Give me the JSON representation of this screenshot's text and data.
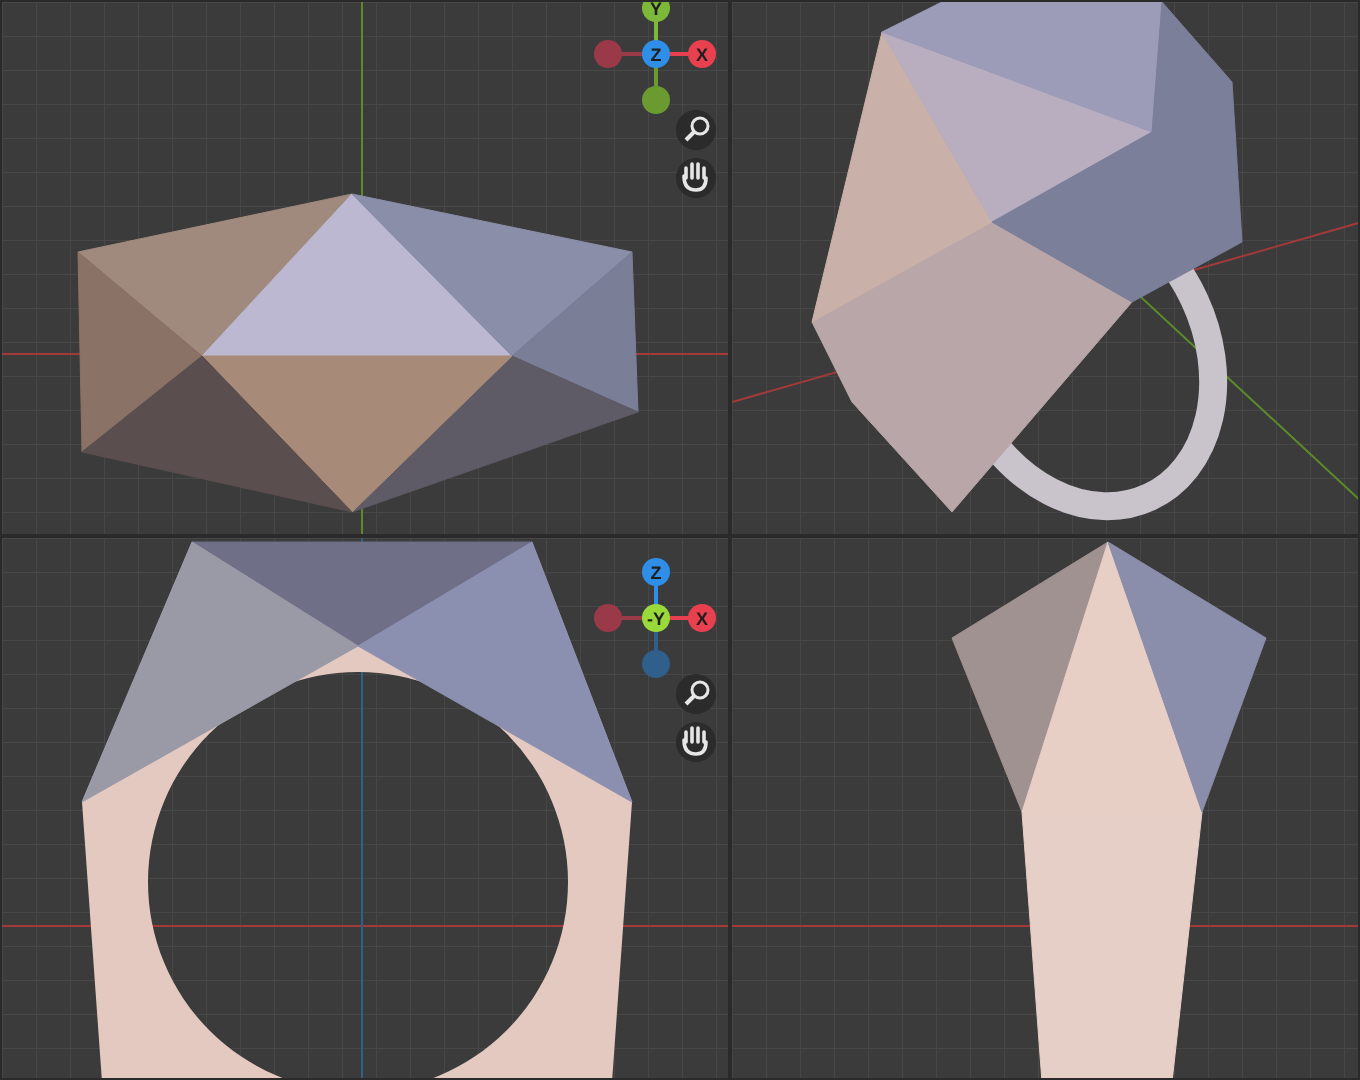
{
  "viewports": [
    {
      "kind": "front",
      "gizmo": {
        "axes": [
          {
            "kind": "top",
            "label": "Y",
            "color": "#7db83a"
          },
          {
            "kind": "left",
            "color": "#9a3a48"
          },
          {
            "kind": "center",
            "label": "Z",
            "color": "#2e8ee8"
          },
          {
            "kind": "right",
            "label": "X",
            "color": "#e8404f"
          },
          {
            "kind": "bottom",
            "color": "#6a9a30"
          }
        ]
      }
    },
    {
      "kind": "perspective"
    },
    {
      "kind": "side",
      "gizmo": {
        "axes": [
          {
            "kind": "top",
            "label": "Z",
            "color": "#2e8ee8"
          },
          {
            "kind": "left",
            "color": "#9a3a48"
          },
          {
            "kind": "center",
            "label": "-Y",
            "color": "#9ad93a"
          },
          {
            "kind": "right",
            "label": "X",
            "color": "#e8404f"
          },
          {
            "kind": "bottom",
            "color": "#2f5f8a"
          }
        ]
      }
    },
    {
      "kind": "end"
    }
  ]
}
